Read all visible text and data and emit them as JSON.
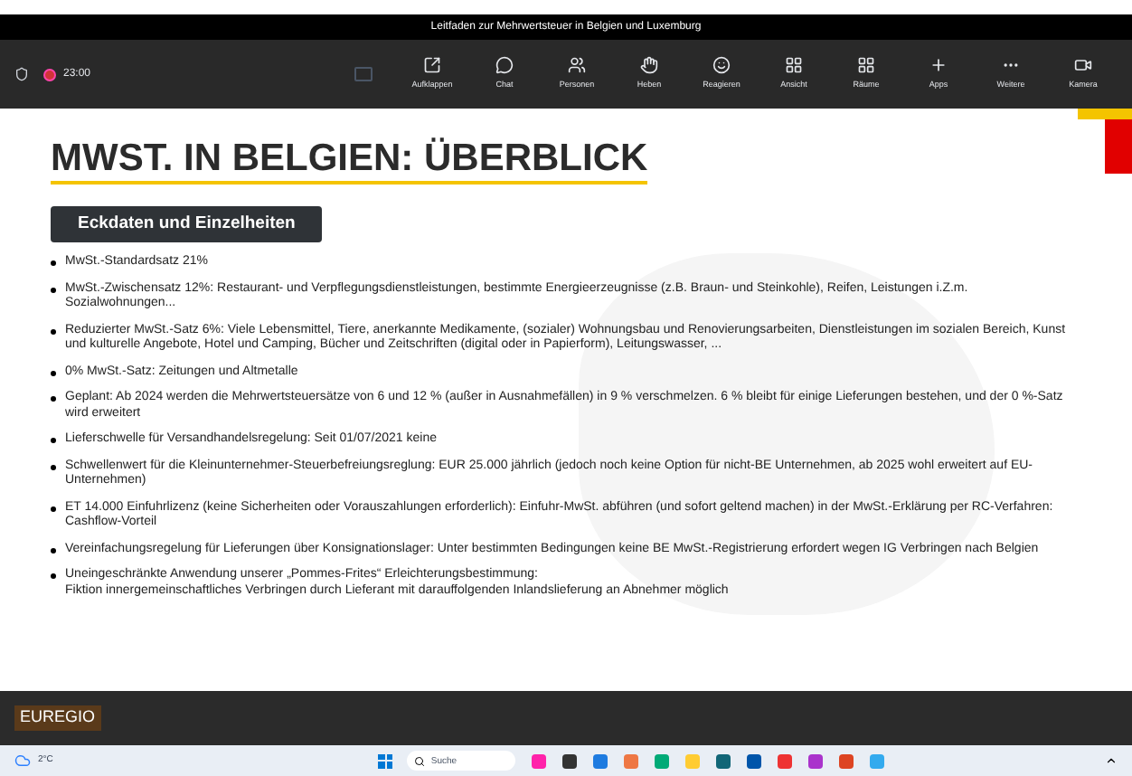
{
  "window": {
    "title": "Leitfaden zur Mehrwertsteuer in Belgien und Luxemburg"
  },
  "meeting_bar": {
    "timer": "23:00",
    "buttons": [
      {
        "label": "Aufklappen"
      },
      {
        "label": "Chat"
      },
      {
        "label": "Personen"
      },
      {
        "label": "Heben"
      },
      {
        "label": "Reagieren"
      },
      {
        "label": "Ansicht"
      },
      {
        "label": "Räume"
      },
      {
        "label": "Apps"
      },
      {
        "label": "Weitere"
      },
      {
        "label": "Kamera"
      }
    ]
  },
  "slide": {
    "title": "MWST. IN BELGIEN: ÜBERBLICK",
    "subtitle": "Eckdaten und Einzelheiten",
    "bullets": [
      "MwSt.-Standardsatz 21%",
      "MwSt.-Zwischensatz 12%: Restaurant- und Verpflegungsdienstleistungen, bestimmte Energieerzeugnisse (z.B. Braun- und Steinkohle), Reifen, Leistungen i.Z.m. Sozialwohnungen...",
      "Reduzierter MwSt.-Satz 6%: Viele Lebensmittel, Tiere, anerkannte Medikamente, (sozialer) Wohnungsbau und Renovierungsarbeiten, Dienstleistungen im sozialen Bereich, Kunst und kulturelle Angebote, Hotel und Camping, Bücher und Zeitschriften (digital oder in Papierform), Leitungswasser, ...",
      "0% MwSt.-Satz: Zeitungen und Altmetalle",
      "Geplant: Ab 2024 werden die Mehrwertsteuersätze von 6 und 12 % (außer in Ausnahmefällen) in 9 % verschmelzen. 6 % bleibt für einige Lieferungen bestehen, und der 0 %-Satz wird erweitert",
      "Lieferschwelle für Versandhandelsregelung: Seit 01/07/2021 keine",
      "Schwellenwert für die Kleinunternehmer-Steuerbefreiungsreglung: EUR 25.000 jährlich (jedoch noch keine Option für nicht-BE Unternehmen, ab 2025 wohl erweitert auf EU-Unternehmen)",
      "ET 14.000 Einfuhrlizenz (keine Sicherheiten oder Vorauszahlungen erforderlich): Einfuhr-MwSt. abführen (und sofort geltend machen) in der MwSt.-Erklärung per RC-Verfahren: Cashflow-Vorteil",
      "Vereinfachungsregelung für Lieferungen über Konsignationslager: Unter bestimmten Bedingungen keine BE MwSt.-Registrierung erfordert wegen IG Verbringen nach Belgien",
      "Uneingeschränkte Anwendung unserer „Pommes-Frites“ Erleichterungsbestimmung:\nFiktion innergemeinschaftliches Verbringen durch Lieferant mit darauffolgenden Inlandslieferung an Abnehmer möglich"
    ]
  },
  "presenter": {
    "logo": "EUREGIO"
  },
  "taskbar": {
    "weather": "2°C",
    "search": {
      "placeholder": "Suche"
    }
  }
}
